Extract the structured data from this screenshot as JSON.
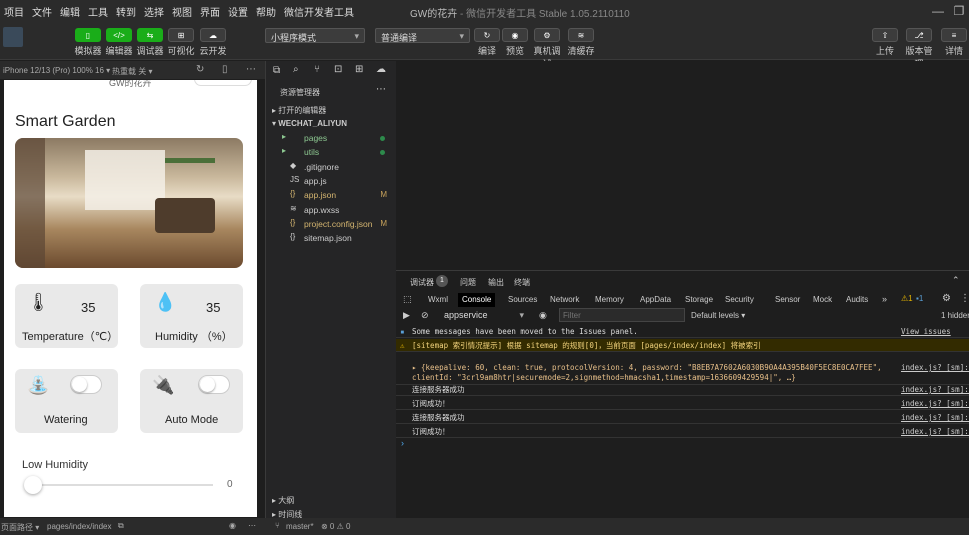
{
  "menu": [
    "项目",
    "文件",
    "编辑",
    "工具",
    "转到",
    "选择",
    "视图",
    "界面",
    "设置",
    "帮助",
    "微信开发者工具"
  ],
  "window": {
    "title": "GW的花卉",
    "subtitle": "- 微信开发者工具 Stable 1.05.2110110"
  },
  "toolbar": {
    "simulator": "模拟器",
    "editor": "编辑器",
    "debugger": "调试器",
    "visual": "可视化",
    "cloud": "云开发",
    "mode": "小程序模式",
    "compile_mode": "普通编译",
    "compile": "编译",
    "preview": "预览",
    "real_debug": "真机调试",
    "clear_cache": "清缓存",
    "upload": "上传",
    "version": "版本管理",
    "details": "详情"
  },
  "simbar": {
    "device": "iPhone 12/13 (Pro) 100% 16 ▾",
    "hot_reload": "热重载 关 ▾"
  },
  "phone": {
    "nav_title": "GW的花卉",
    "title": "Smart Garden",
    "temperature": {
      "value": "35",
      "label": "Temperature（℃）"
    },
    "humidity": {
      "value": "35",
      "label": "Humidity （%）"
    },
    "watering": {
      "label": "Watering"
    },
    "auto": {
      "label": "Auto Mode"
    },
    "low_humidity": "Low Humidity",
    "slider_value": "0"
  },
  "left_footer": {
    "path_label": "页面路径 ▾",
    "path": "pages/index/index"
  },
  "explorer": {
    "title": "资源管理器",
    "open_editors": "打开的编辑器",
    "project": "WECHAT_ALIYUN",
    "files": [
      {
        "name": "pages",
        "icon": "▸",
        "color": "#8dc891",
        "mark": "dot"
      },
      {
        "name": "utils",
        "icon": "▸",
        "color": "#8dc891",
        "mark": "dot"
      },
      {
        "name": ".gitignore",
        "icon": "◆",
        "color": "#ccc",
        "mark": ""
      },
      {
        "name": "app.js",
        "icon": "JS",
        "color": "#ccc",
        "mark": ""
      },
      {
        "name": "app.json",
        "icon": "{}",
        "color": "#d4b570",
        "mark": "M"
      },
      {
        "name": "app.wxss",
        "icon": "≋",
        "color": "#ccc",
        "mark": ""
      },
      {
        "name": "project.config.json",
        "icon": "{}",
        "color": "#d4b570",
        "mark": "M"
      },
      {
        "name": "sitemap.json",
        "icon": "{}",
        "color": "#ccc",
        "mark": ""
      }
    ],
    "outline": "大纲",
    "timeline": "时间线"
  },
  "debug": {
    "tab_debugger": "调试器",
    "badge": "1",
    "tab_issues": "问题",
    "tab_output": "输出",
    "tab_terminal": "终端",
    "tabs": [
      "Wxml",
      "Console",
      "Sources",
      "Network",
      "Memory",
      "AppData",
      "Storage",
      "Security",
      "Sensor",
      "Mock",
      "Audits"
    ],
    "warn_count": "1",
    "info_count": "1",
    "context": "appservice",
    "filter_placeholder": "Filter",
    "levels": "Default levels ▾",
    "hidden": "1 hidden",
    "lines": [
      {
        "text": "Some messages have been moved to the Issues panel.",
        "src": "View issues",
        "type": "info"
      },
      {
        "text": "[sitemap 索引情况提示] 根据 sitemap 的规则[0]，当前页面 [pages/index/index] 将被索引",
        "src": "",
        "type": "warn"
      },
      {
        "text": "▸ {keepalive: 60, clean: true, protocolVersion: 4, password: \"B8EB7A7602A6030B90A4A395B40F5EC8E0CA7FEE\", clientId: \"3crl9am8htr|securemode=2,signmethod=hmacsha1,timestamp=1636609429594|\", …}",
        "src": "index.js? [sm]:21",
        "type": "obj"
      },
      {
        "text": "连接服务器成功",
        "src": "index.js? [sm]:32",
        "type": "log"
      },
      {
        "text": "订阅成功！",
        "src": "index.js? [sm]:37",
        "type": "log"
      },
      {
        "text": "连接服务器成功",
        "src": "index.js? [sm]:32",
        "type": "log"
      },
      {
        "text": "订阅成功！",
        "src": "index.js? [sm]:37",
        "type": "log"
      }
    ]
  },
  "bottom": {
    "branch": "master*",
    "problems": "⊗ 0 ⚠ 0"
  }
}
